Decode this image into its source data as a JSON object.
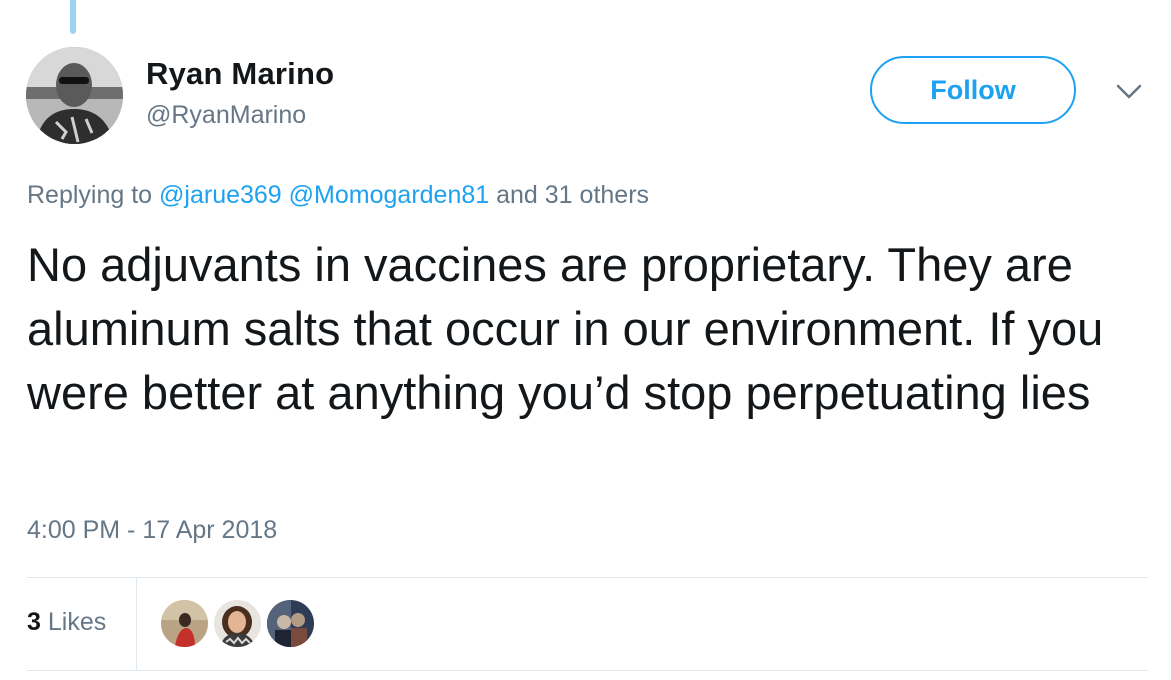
{
  "author": {
    "display_name": "Ryan Marino",
    "handle": "@RyanMarino"
  },
  "follow_button": {
    "label": "Follow"
  },
  "reply_context": {
    "prefix": "Replying to",
    "mentions": [
      "@jarue369",
      "@Momogarden81"
    ],
    "suffix": "and 31 others"
  },
  "tweet": {
    "text": "No adjuvants in vaccines are proprietary. They are aluminum salts that occur in our environment. If you were better at anything you’d stop perpetuating lies",
    "timestamp": "4:00 PM - 17 Apr 2018"
  },
  "stats": {
    "likes_count": "3",
    "likes_label": "Likes"
  },
  "colors": {
    "accent": "#1da1f2",
    "secondary_text": "#657786",
    "primary_text": "#14171a",
    "divider": "#e1e8ed",
    "thread_line": "#9fd3f5"
  },
  "icons": {
    "menu": "chevron-down-icon"
  }
}
